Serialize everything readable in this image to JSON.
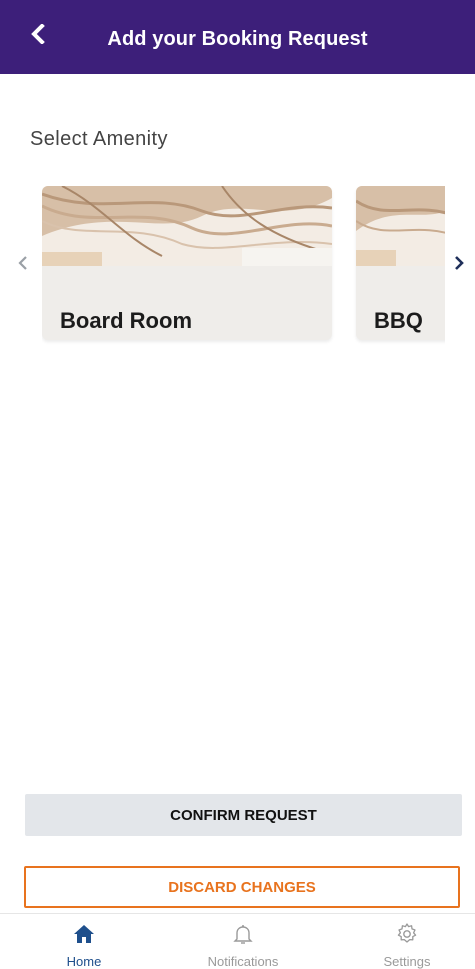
{
  "header": {
    "title": "Add your Booking Request",
    "back_icon": "back-chevron-icon"
  },
  "amenity_section": {
    "label": "Select Amenity"
  },
  "amenities": [
    {
      "name": "Board Room",
      "image": "curved-wood-ceiling-photo"
    },
    {
      "name": "BBQ",
      "image": "curved-wood-ceiling-photo"
    }
  ],
  "actions": {
    "confirm_label": "CONFIRM REQUEST",
    "discard_label": "DISCARD CHANGES"
  },
  "bottom_nav": {
    "items": [
      {
        "label": "Home",
        "icon": "home-icon",
        "active": true
      },
      {
        "label": "Notifications",
        "icon": "bell-icon",
        "active": false
      },
      {
        "label": "Settings",
        "icon": "gear-icon",
        "active": false
      }
    ]
  },
  "colors": {
    "header_bg": "#3d1f7a",
    "accent_orange": "#e8731e",
    "active_nav": "#1e4f8c",
    "inactive_nav": "#9a9a9a",
    "confirm_bg": "#e3e6ea"
  }
}
